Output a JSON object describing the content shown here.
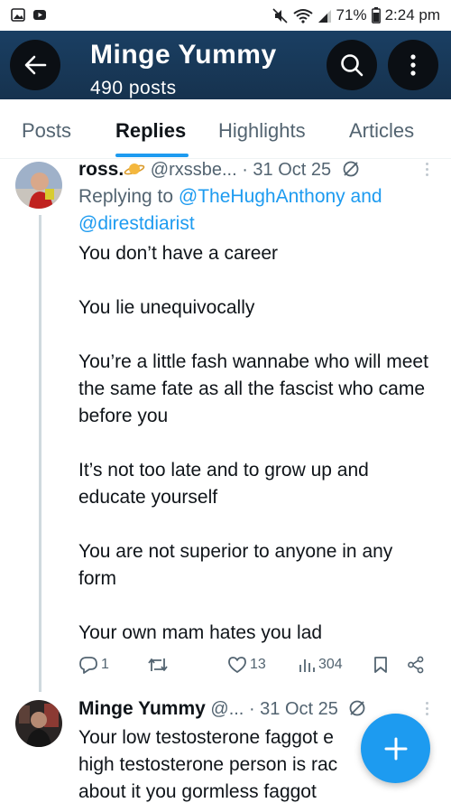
{
  "status_bar": {
    "battery": "71%",
    "time": "2:24 pm"
  },
  "header": {
    "title": "Minge Yummy",
    "subtitle": "490 posts"
  },
  "tabs": [
    {
      "label": "Posts",
      "active": false
    },
    {
      "label": "Replies",
      "active": true
    },
    {
      "label": "Highlights",
      "active": false
    },
    {
      "label": "Articles",
      "active": false
    }
  ],
  "posts": [
    {
      "name": "ross.",
      "badge_icon": "planet-emoji",
      "handle": "@rxssbe...",
      "date": "· 31 Oct 25",
      "replying_prefix": "Replying to",
      "replying_user1": "@TheHughAnthony",
      "replying_and": "and",
      "replying_user2": "@direstdiarist",
      "paragraphs": [
        "You don’t have a career",
        "You lie unequivocally",
        "You’re a little fash wannabe who will meet the same fate as all the fascist who came before you",
        "It’s not too late and to grow up and educate yourself",
        "You are not superior to anyone in any form",
        "Your own mam hates you lad"
      ],
      "stats": {
        "replies": "1",
        "reposts": "",
        "likes": "13",
        "views": "304"
      }
    },
    {
      "name": "Minge Yummy",
      "handle": "@...",
      "date": "· 31 Oct 25",
      "lines": [
        "Your low testosterone faggot e",
        "high testosterone person is rac",
        "about it  you gormless faggot"
      ]
    }
  ],
  "colors": {
    "accent": "#1d9bf0",
    "header_bg": "#1a3f63",
    "muted_text": "#536471"
  }
}
